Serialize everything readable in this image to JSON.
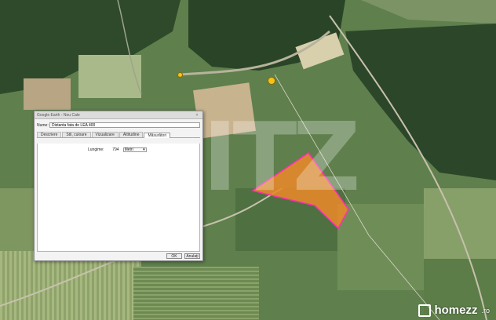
{
  "dialog": {
    "title": "Google Earth - Nou Cale",
    "close_glyph": "×",
    "name_label": "Nume:",
    "name_value": "Distanta fata de LEA 400",
    "tabs": [
      {
        "label": "Descriere",
        "active": false
      },
      {
        "label": "Stil, culoare",
        "active": false
      },
      {
        "label": "Vizualizare",
        "active": false
      },
      {
        "label": "Altitudine",
        "active": false
      },
      {
        "label": "Măsurători",
        "active": true
      }
    ],
    "length_label": "Lungime:",
    "length_value": "794",
    "length_unit": "Metri",
    "ok_label": "OK",
    "cancel_label": "Anulați"
  },
  "watermark": {
    "text": "ITZ"
  },
  "brand": {
    "name": "homezz",
    "suffix": ".ro"
  },
  "colors": {
    "polygon_fill": "#e8892a",
    "polygon_stroke": "#ff2fb0",
    "pin": "#f6c21a"
  }
}
